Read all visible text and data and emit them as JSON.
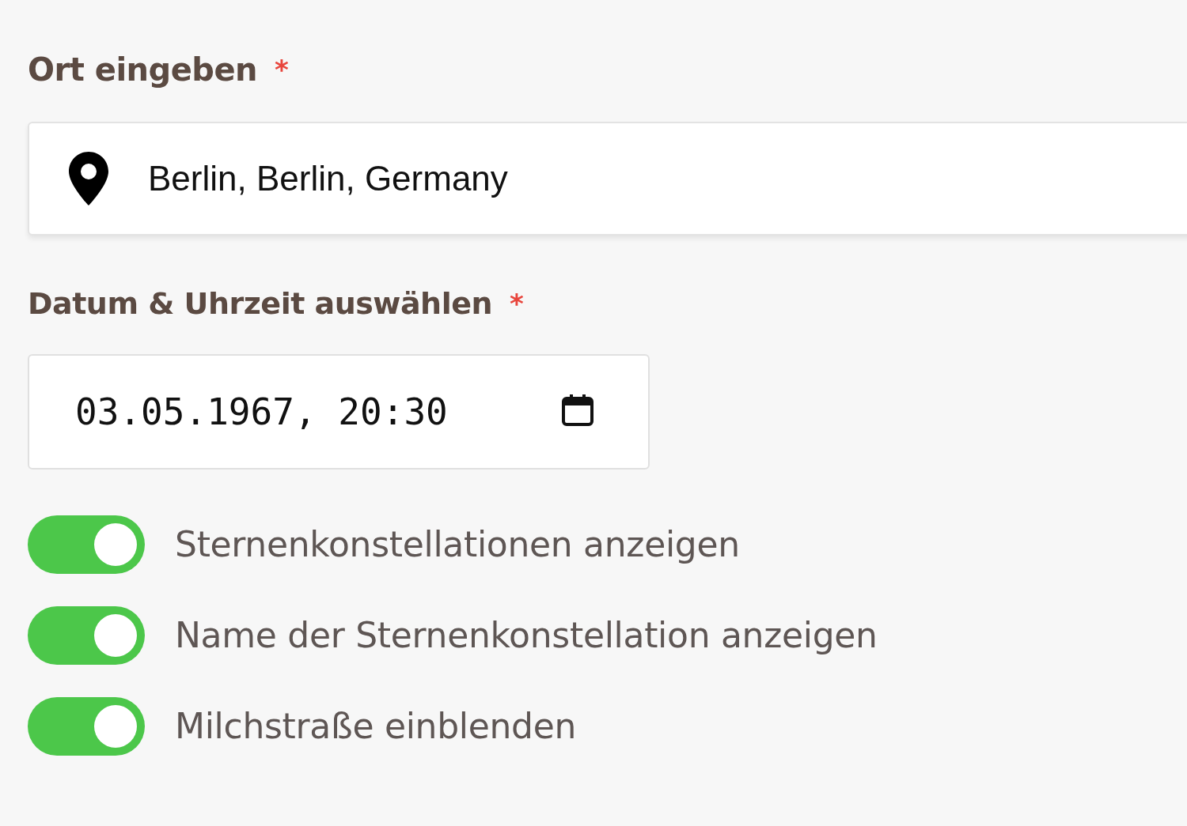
{
  "location": {
    "label": "Ort eingeben",
    "required_mark": "*",
    "value": "Berlin, Berlin, Germany"
  },
  "datetime": {
    "label": "Datum & Uhrzeit auswählen",
    "required_mark": "*",
    "value": "03.05.1967, 20:30"
  },
  "toggles": [
    {
      "label": "Sternenkonstellationen anzeigen",
      "on": true
    },
    {
      "label": "Name der Sternenkonstellation anzeigen",
      "on": true
    },
    {
      "label": "Milchstraße einblenden",
      "on": true
    }
  ]
}
